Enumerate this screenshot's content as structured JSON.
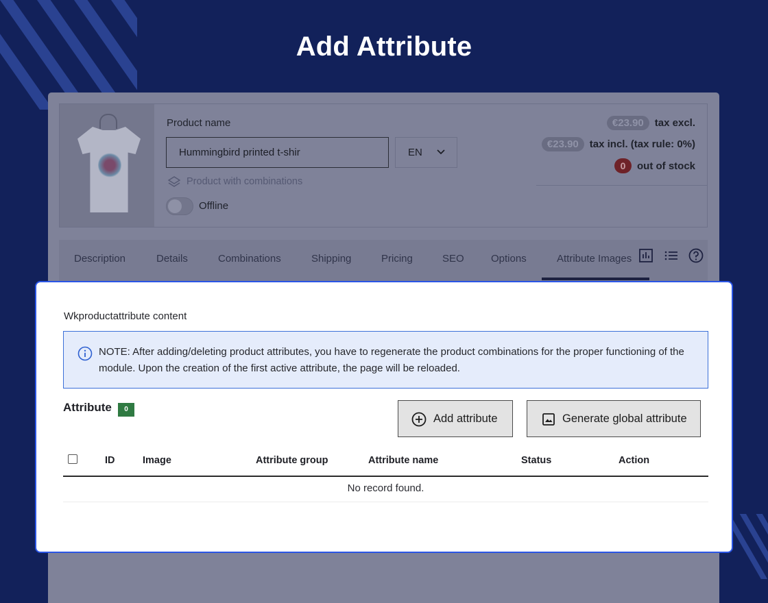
{
  "page": {
    "title": "Add Attribute"
  },
  "product": {
    "name_label": "Product name",
    "name_value": "Hummingbird printed t-shir",
    "language": "EN",
    "type_label": "Product with combinations",
    "status_label": "Offline",
    "price_tax_excl": "€23.90",
    "price_tax_excl_label": "tax excl.",
    "price_tax_incl": "€23.90",
    "price_tax_incl_label": "tax incl. (tax rule: 0%)",
    "stock_count": "0",
    "stock_label": "out of stock"
  },
  "tabs": [
    {
      "label": "Description"
    },
    {
      "label": "Details"
    },
    {
      "label": "Combinations"
    },
    {
      "label": "Shipping"
    },
    {
      "label": "Pricing"
    },
    {
      "label": "SEO"
    },
    {
      "label": "Options"
    },
    {
      "label": "Attribute Images"
    }
  ],
  "tab_icons": [
    "chart-icon",
    "list-icon",
    "help-icon"
  ],
  "modal": {
    "module_title": "Wkproductattribute content",
    "note": "NOTE: After adding/deleting product attributes, you have to regenerate the product combinations for the proper functioning of the module. Upon the creation of the first active attribute, the page will be reloaded.",
    "section_title": "Attribute",
    "count": "0",
    "add_button": "Add attribute",
    "generate_button": "Generate global attribute",
    "columns": [
      "ID",
      "Image",
      "Attribute group",
      "Attribute name",
      "Status",
      "Action"
    ],
    "empty_message": "No record found."
  },
  "colors": {
    "background": "#12215a",
    "modal_border": "#2a55e6",
    "note_background": "#e5ecfb",
    "count_badge": "#2f7a42"
  }
}
